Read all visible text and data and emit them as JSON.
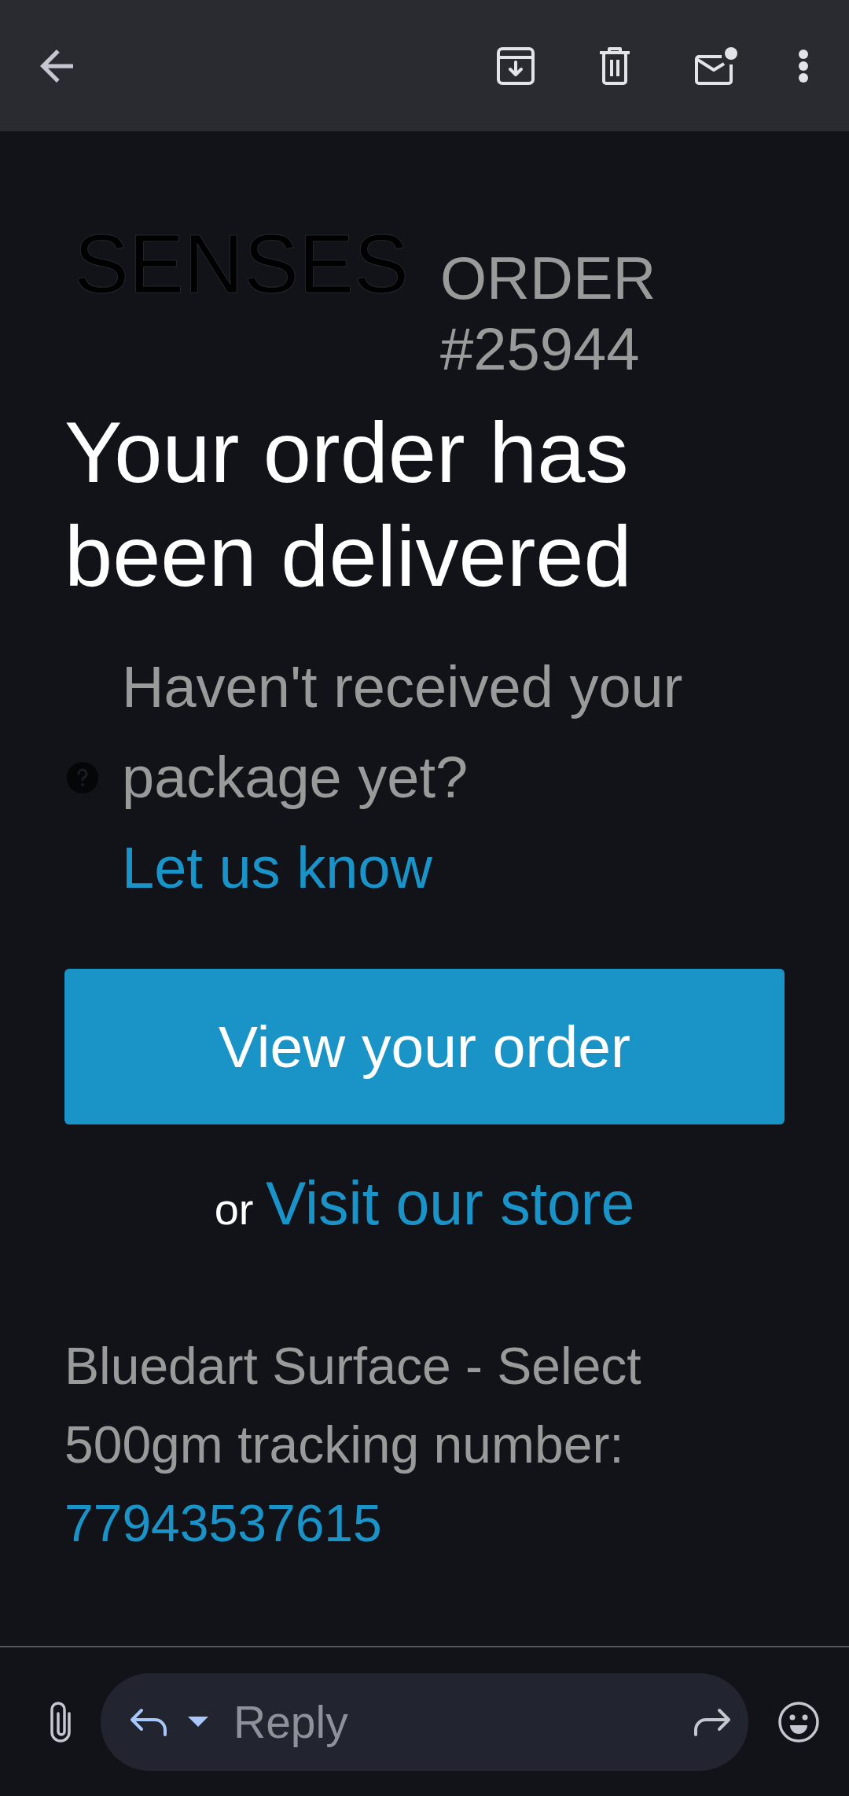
{
  "email": {
    "logo": "SENSES",
    "order_label": "ORDER #25944",
    "heading": "Your order has been delivered",
    "help_text": "Haven't received your package yet?",
    "help_link": "Let us know",
    "primary_button": "View your order",
    "alt_prefix": "or",
    "alt_link": "Visit our store",
    "shipping_text": "Bluedart Surface - Select 500gm tracking number:",
    "tracking_number": "77943537615"
  },
  "reply_bar": {
    "placeholder": "Reply"
  }
}
